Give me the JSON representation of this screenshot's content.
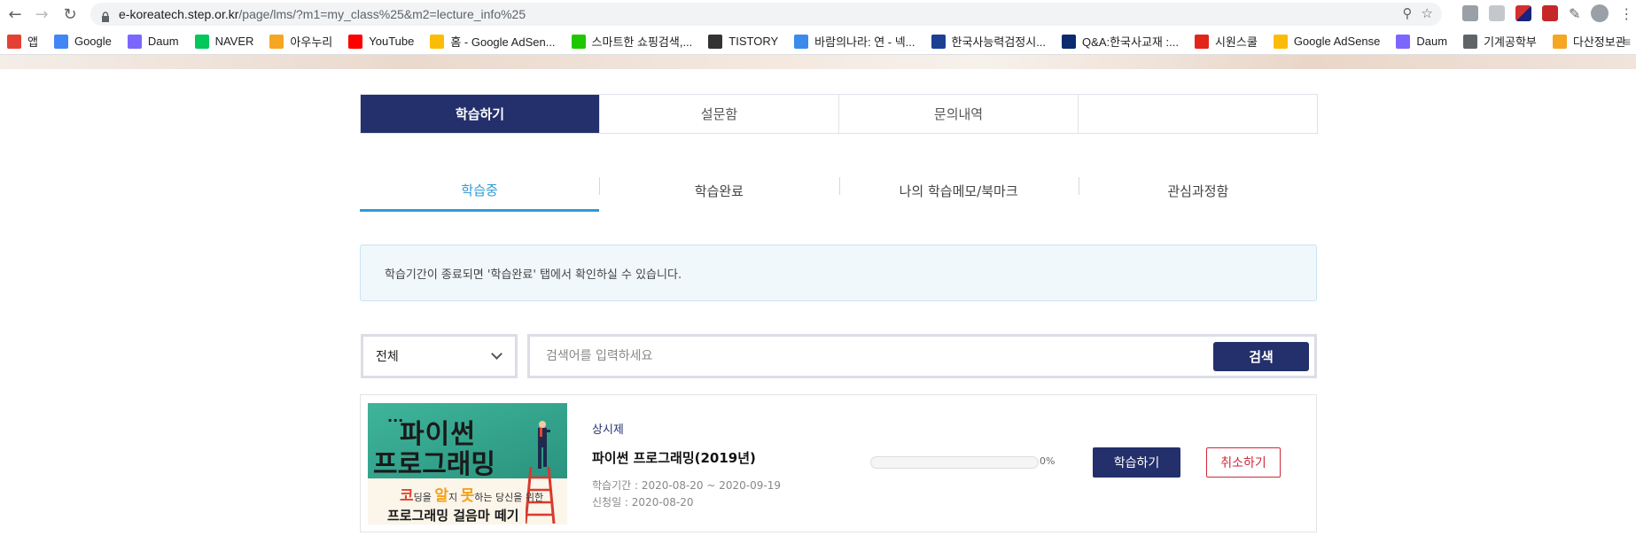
{
  "browser": {
    "url_host": "e-koreatech.step.or.kr",
    "url_path": "/page/lms/?m1=my_class%25&m2=lecture_info%25",
    "bookmarks": [
      {
        "label": "앱",
        "icon": "apps-grid-icon",
        "color": "#e44134"
      },
      {
        "label": "Google",
        "icon": "google-icon",
        "color": "#4285f4"
      },
      {
        "label": "Daum",
        "icon": "daum-icon",
        "color": "#7b66ff"
      },
      {
        "label": "NAVER",
        "icon": "naver-icon",
        "color": "#03c75a"
      },
      {
        "label": "아우누리",
        "icon": "aunuri-icon",
        "color": "#f5a623"
      },
      {
        "label": "YouTube",
        "icon": "youtube-icon",
        "color": "#ff0000"
      },
      {
        "label": "홈 - Google AdSen...",
        "icon": "adsense-icon",
        "color": "#fbbc05"
      },
      {
        "label": "스마트한 쇼핑검색,...",
        "icon": "danawa-icon",
        "color": "#1ec800"
      },
      {
        "label": "TISTORY",
        "icon": "tistory-icon",
        "color": "#333333"
      },
      {
        "label": "바람의나라: 연 - 넥...",
        "icon": "chat-bubble-icon",
        "color": "#3b8bea"
      },
      {
        "label": "한국사능력검정시...",
        "icon": "gsc-icon",
        "color": "#1c3f94"
      },
      {
        "label": "Q&A:한국사교재 :...",
        "icon": "h-logo-icon",
        "color": "#0a2b6e"
      },
      {
        "label": "시원스쿨",
        "icon": "siwon-icon",
        "color": "#e1251b"
      },
      {
        "label": "Google AdSense",
        "icon": "adsense-icon",
        "color": "#fbbc05"
      },
      {
        "label": "Daum",
        "icon": "daum-icon",
        "color": "#7b66ff"
      },
      {
        "label": "기계공학부",
        "icon": "globe-icon",
        "color": "#5f6368"
      },
      {
        "label": "다산정보관",
        "icon": "dasan-icon",
        "color": "#f5a623"
      }
    ]
  },
  "main_tabs": [
    {
      "label": "학습하기",
      "active": true
    },
    {
      "label": "설문함",
      "active": false
    },
    {
      "label": "문의내역",
      "active": false
    },
    {
      "label": "",
      "active": false
    }
  ],
  "sub_tabs": [
    {
      "label": "학습중",
      "active": true
    },
    {
      "label": "학습완료",
      "active": false
    },
    {
      "label": "나의 학습메모/북마크",
      "active": false
    },
    {
      "label": "관심과정함",
      "active": false
    }
  ],
  "notice": "학습기간이 종료되면 '학습완료' 탭에서 확인하실 수 있습니다.",
  "search": {
    "filter_value": "전체",
    "placeholder": "검색어를 입력하세요",
    "button_label": "검색"
  },
  "course": {
    "thumbnail": {
      "line1": "파이썬",
      "line2": "프로그래밍",
      "dots": "···",
      "sub_r": "코",
      "sub_mid1": "딩을 ",
      "sub_o1": "알",
      "sub_mid2": "지 ",
      "sub_o2": "못",
      "sub_end": "하는 당신을 위한",
      "bottom": "프로그래밍 걸음마 떼기"
    },
    "category": "상시제",
    "title": "파이썬 프로그래밍(2019년)",
    "period": "학습기간 : 2020-08-20 ~ 2020-09-19",
    "applied": "신청일 : 2020-08-20",
    "progress_percent": 0,
    "progress_label": "0%",
    "study_button": "학습하기",
    "cancel_button": "취소하기"
  },
  "colors": {
    "navy": "#24306b",
    "accent_blue": "#2f9bd6",
    "cancel_red": "#d0283a"
  }
}
